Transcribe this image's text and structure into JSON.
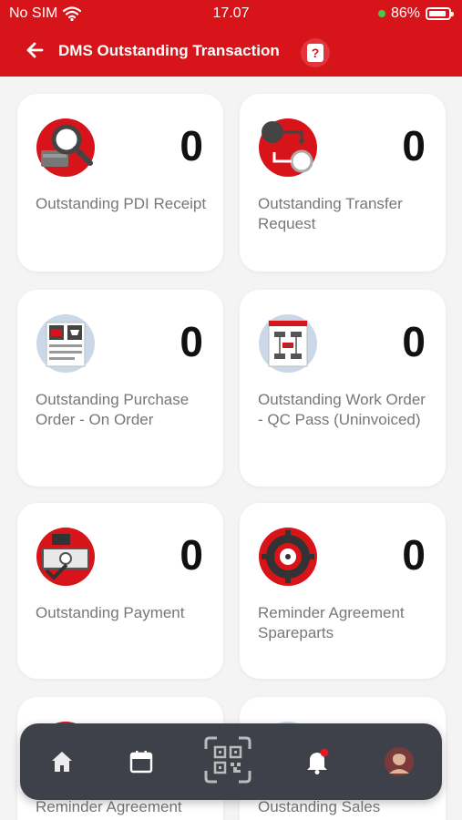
{
  "status_bar": {
    "carrier": "No SIM",
    "time": "17.07",
    "battery": "86%",
    "icons": [
      "wifi-icon",
      "battery-icon"
    ]
  },
  "header": {
    "title": "DMS Outstanding Transaction",
    "back_icon": "arrow-left-icon",
    "help_icon": "help-icon",
    "background": "#d8141b"
  },
  "cards": [
    {
      "label": "Outstanding PDI Receipt",
      "count": "0",
      "icon": "pdi-receipt-icon"
    },
    {
      "label": "Outstanding Transfer Request",
      "count": "0",
      "icon": "transfer-request-icon"
    },
    {
      "label": "Outstanding Purchase Order - On Order",
      "count": "0",
      "icon": "purchase-order-icon"
    },
    {
      "label": "Outstanding Work Order - QC Pass (Uninvoiced)",
      "count": "0",
      "icon": "work-order-icon"
    },
    {
      "label": "Outstanding Payment",
      "count": "0",
      "icon": "payment-icon"
    },
    {
      "label": "Reminder Agreement Spareparts",
      "count": "0",
      "icon": "spareparts-icon"
    },
    {
      "label": "Reminder Agreement",
      "icon": "reminder-agreement-icon"
    },
    {
      "label": "Oustanding Sales",
      "icon": "sales-icon"
    }
  ],
  "bottom_nav": {
    "items": [
      "home-icon",
      "calendar-icon",
      "qr-code-icon",
      "notification-bell-icon",
      "profile-avatar"
    ],
    "notification_badge": "#e11b22"
  }
}
